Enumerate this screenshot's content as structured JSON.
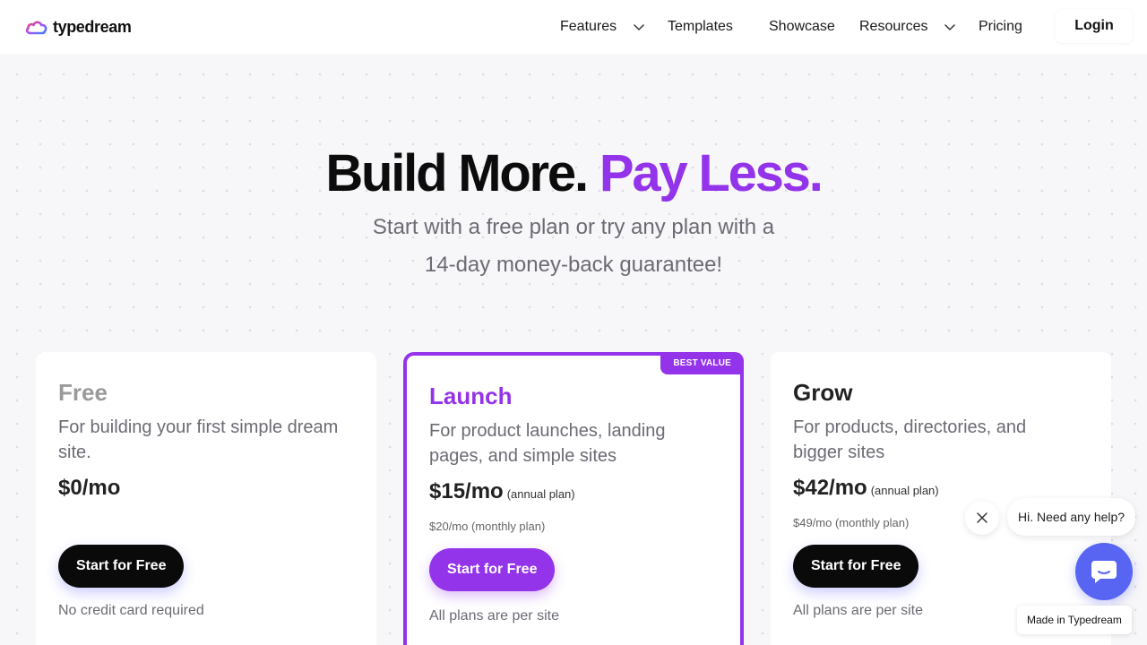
{
  "header": {
    "brand": "typedream",
    "nav": {
      "features": "Features",
      "templates": "Templates",
      "showcase": "Showcase",
      "resources": "Resources",
      "pricing": "Pricing"
    },
    "login": "Login"
  },
  "hero": {
    "title_dark": "Build More.",
    "title_accent": "Pay Less.",
    "subtitle_line1": "Start with a free plan or try any plan with a",
    "subtitle_line2": "14-day money-back guarantee!"
  },
  "plans": {
    "free": {
      "name": "Free",
      "description": "For building your first simple dream site.",
      "price": "$0/mo",
      "cta": "Start for Free",
      "note": "No credit card required"
    },
    "launch": {
      "badge": "BEST VALUE",
      "name": "Launch",
      "description": "For product launches, landing pages, and simple sites",
      "price": "$15/mo",
      "price_qualifier": "(annual plan)",
      "monthly": "$20/mo (monthly plan)",
      "cta": "Start for Free",
      "note": "All plans are per site"
    },
    "grow": {
      "name": "Grow",
      "description": "For products, directories, and bigger sites",
      "price": "$42/mo",
      "price_qualifier": "(annual plan)",
      "monthly": "$49/mo (monthly plan)",
      "cta": "Start for Free",
      "note": "All plans are per site"
    }
  },
  "chat": {
    "greeting": "Hi. Need any help?",
    "made_in": "Made in Typedream"
  },
  "colors": {
    "accent": "#9333ea",
    "chat": "#5865f2",
    "free_name": "#9a9a9a",
    "launch_name": "#9333ea",
    "grow_name": "#222222"
  },
  "icons": {
    "logo": "cloud-logo-icon",
    "dropdown": "chevron-down-icon",
    "close": "close-icon",
    "chat": "chat-bubble-icon"
  }
}
